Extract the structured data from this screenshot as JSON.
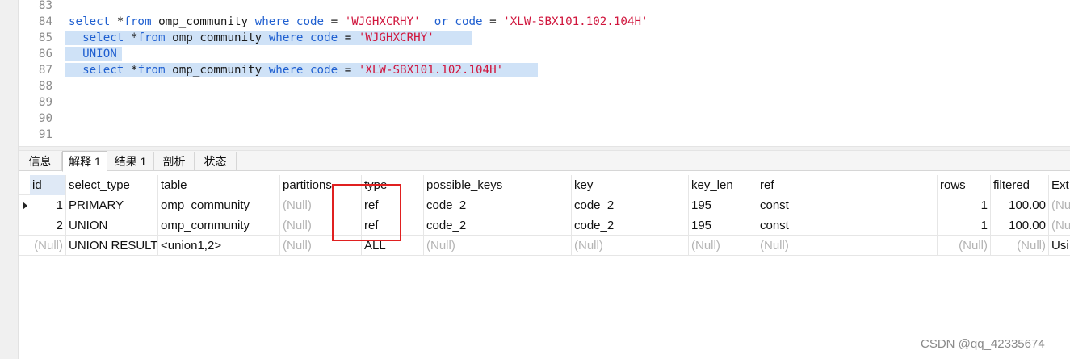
{
  "editor": {
    "lines": [
      {
        "num": "83",
        "code": ""
      },
      {
        "num": "84",
        "code": "select *from omp_community where code = 'WJGHXCRHY'  or code = 'XLW-SBX101.102.104H'"
      },
      {
        "num": "85",
        "code": "  select *from omp_community where code = 'WJGHXCRHY'"
      },
      {
        "num": "86",
        "code": "  UNION"
      },
      {
        "num": "87",
        "code": "  select *from omp_community where code = 'XLW-SBX101.102.104H'"
      },
      {
        "num": "88",
        "code": ""
      },
      {
        "num": "89",
        "code": ""
      },
      {
        "num": "90",
        "code": ""
      },
      {
        "num": "91",
        "code": ""
      }
    ],
    "selected_lines": [
      "85",
      "86",
      "87"
    ]
  },
  "tabs": [
    {
      "label": "信息",
      "active": false
    },
    {
      "label": "解释 1",
      "active": true
    },
    {
      "label": "结果 1",
      "active": false
    },
    {
      "label": "剖析",
      "active": false
    },
    {
      "label": "状态",
      "active": false
    }
  ],
  "grid": {
    "columns": [
      "id",
      "select_type",
      "table",
      "partitions",
      "type",
      "possible_keys",
      "key",
      "key_len",
      "ref",
      "rows",
      "filtered",
      "Ext"
    ],
    "sorted_column": "id",
    "rows": [
      [
        "1",
        "PRIMARY",
        "omp_community",
        "(Null)",
        "ref",
        "code_2",
        "code_2",
        "195",
        "const",
        "1",
        "100.00",
        "(Nu"
      ],
      [
        "2",
        "UNION",
        "omp_community",
        "(Null)",
        "ref",
        "code_2",
        "code_2",
        "195",
        "const",
        "1",
        "100.00",
        "(Nu"
      ],
      [
        "(Null)",
        "UNION RESULT",
        "<union1,2>",
        "(Null)",
        "ALL",
        "(Null)",
        "(Null)",
        "(Null)",
        "(Null)",
        "(Null)",
        "(Null)",
        "Usi"
      ]
    ],
    "current_row": 0
  },
  "watermark": "CSDN @qq_42335674",
  "colors": {
    "keyword": "#1f5fd0",
    "string": "#d0163d",
    "selection": "#cfe2f7",
    "null_text": "#b4b4b4",
    "highlight_box": "#e02020"
  }
}
